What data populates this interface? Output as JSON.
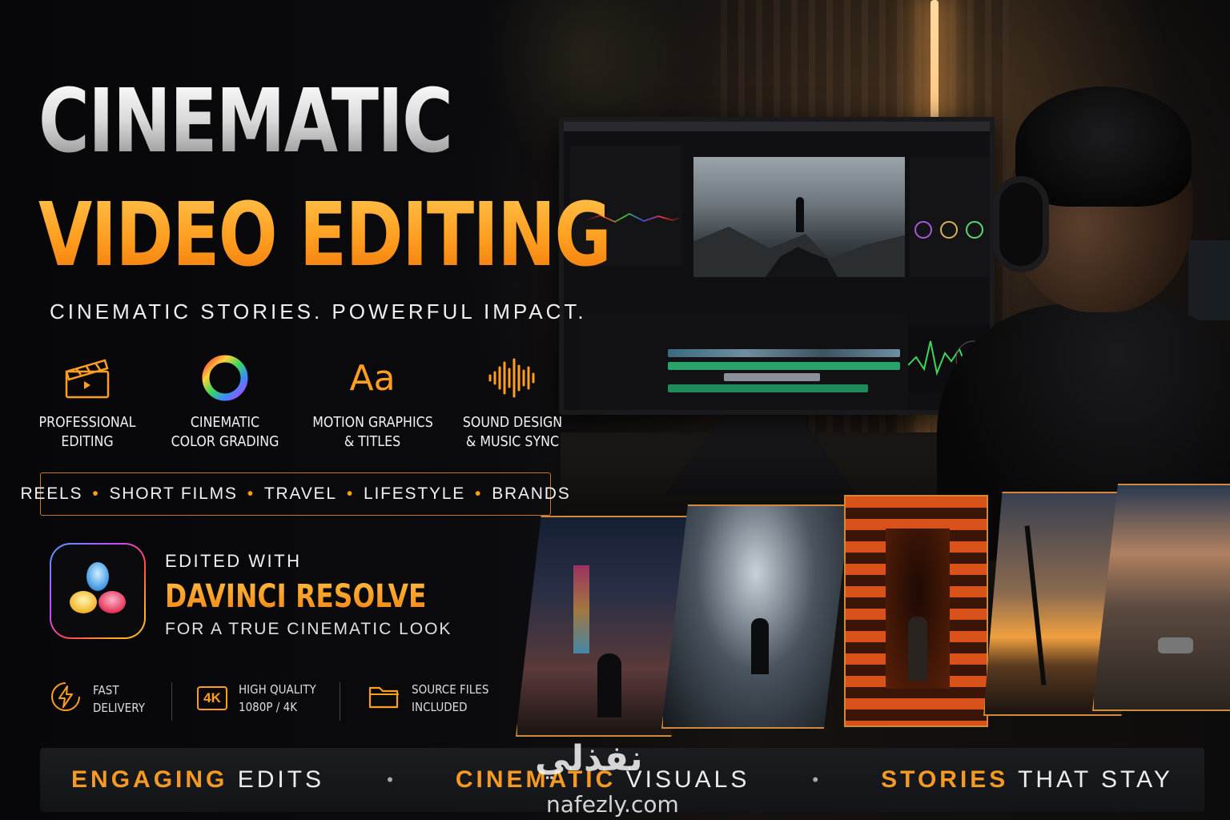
{
  "hero": {
    "title_line1": "CINEMATIC",
    "title_line2": "VIDEO EDITING",
    "tagline": "CINEMATIC STORIES. POWERFUL IMPACT."
  },
  "features": [
    {
      "icon": "clapperboard-icon",
      "line1": "PROFESSIONAL",
      "line2": "EDITING"
    },
    {
      "icon": "color-wheel-icon",
      "line1": "CINEMATIC",
      "line2": "COLOR GRADING"
    },
    {
      "icon": "typography-icon",
      "glyph": "Aa",
      "line1": "MOTION GRAPHICS",
      "line2": "& TITLES"
    },
    {
      "icon": "sound-wave-icon",
      "line1": "SOUND DESIGN",
      "line2": "& MUSIC SYNC"
    }
  ],
  "categories": [
    "REELS",
    "SHORT FILMS",
    "TRAVEL",
    "LIFESTYLE",
    "BRANDS"
  ],
  "software": {
    "edited_with": "EDITED WITH",
    "name": "DAVINCI RESOLVE",
    "subtitle": "FOR A TRUE CINEMATIC LOOK",
    "logo_icon": "davinci-resolve-logo"
  },
  "perks": [
    {
      "icon": "lightning-icon",
      "line1": "FAST",
      "line2": "DELIVERY"
    },
    {
      "icon": "4k-badge-icon",
      "badge": "4K",
      "line1": "HIGH QUALITY",
      "line2": "1080P / 4K"
    },
    {
      "icon": "folder-icon",
      "line1": "SOURCE FILES",
      "line2": "INCLUDED"
    }
  ],
  "photos": [
    {
      "name": "photo-city-night",
      "icon": "city-street-photo"
    },
    {
      "name": "photo-train",
      "icon": "train-interior-photo"
    },
    {
      "name": "photo-torii-gates",
      "icon": "torii-gates-photo"
    },
    {
      "name": "photo-palm-sunset",
      "icon": "palm-sunset-photo"
    },
    {
      "name": "photo-coastal-road",
      "icon": "coastal-road-photo"
    }
  ],
  "slogans": [
    {
      "highlight": "ENGAGING",
      "rest": " EDITS"
    },
    {
      "highlight": "CINEMATIC",
      "rest": " VISUALS"
    },
    {
      "highlight": "STORIES",
      "rest": " THAT STAY"
    }
  ],
  "watermark": {
    "arabic": "نفذلي",
    "latin": "nafezly.com"
  },
  "colors": {
    "accent": "#ff9e1f",
    "border": "#c7742a",
    "background": "#0a0a0c"
  }
}
